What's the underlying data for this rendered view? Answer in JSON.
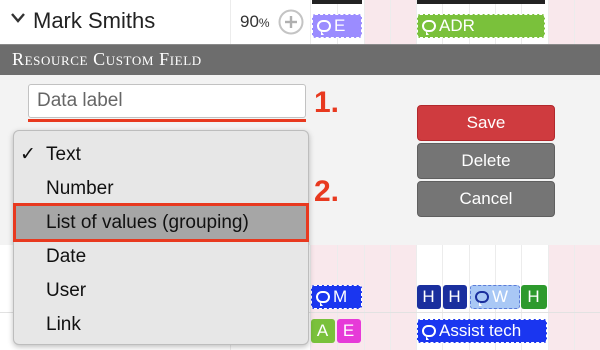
{
  "row": {
    "name": "Mark Smiths",
    "percent": "90",
    "percent_unit": "%",
    "add_icon": "plus-circle-icon"
  },
  "chips_top": {
    "e_chip": "E",
    "adr_chip": "ADR"
  },
  "header": {
    "title": "Resource Custom Field"
  },
  "form": {
    "data_label_placeholder": "Data label",
    "type_options": [
      {
        "label": "Text",
        "checked": true
      },
      {
        "label": "Number",
        "checked": false
      },
      {
        "label": "List of values (grouping)",
        "checked": false
      },
      {
        "label": "Date",
        "checked": false
      },
      {
        "label": "User",
        "checked": false
      },
      {
        "label": "Link",
        "checked": false
      }
    ],
    "checkmark": "✓"
  },
  "buttons": {
    "save": "Save",
    "delete": "Delete",
    "cancel": "Cancel"
  },
  "callouts": {
    "one": "1.",
    "two": "2."
  },
  "chips_bottom": {
    "m_chip": "M",
    "h1": "H",
    "h2": "H",
    "w_chip": "W",
    "h3": "H",
    "a_chip": "A",
    "e_chip": "E",
    "assist_chip": "Assist tech"
  },
  "colors": {
    "accent_red": "#e8391f",
    "save_red": "#cf3b3f",
    "header_gray": "#6d6d6d",
    "chip_purple": "#9b8cff",
    "chip_green": "#7ac13b",
    "chip_blue": "#1a36f0",
    "chip_navy": "#1a2f9e",
    "chip_magenta": "#e63ad8"
  }
}
